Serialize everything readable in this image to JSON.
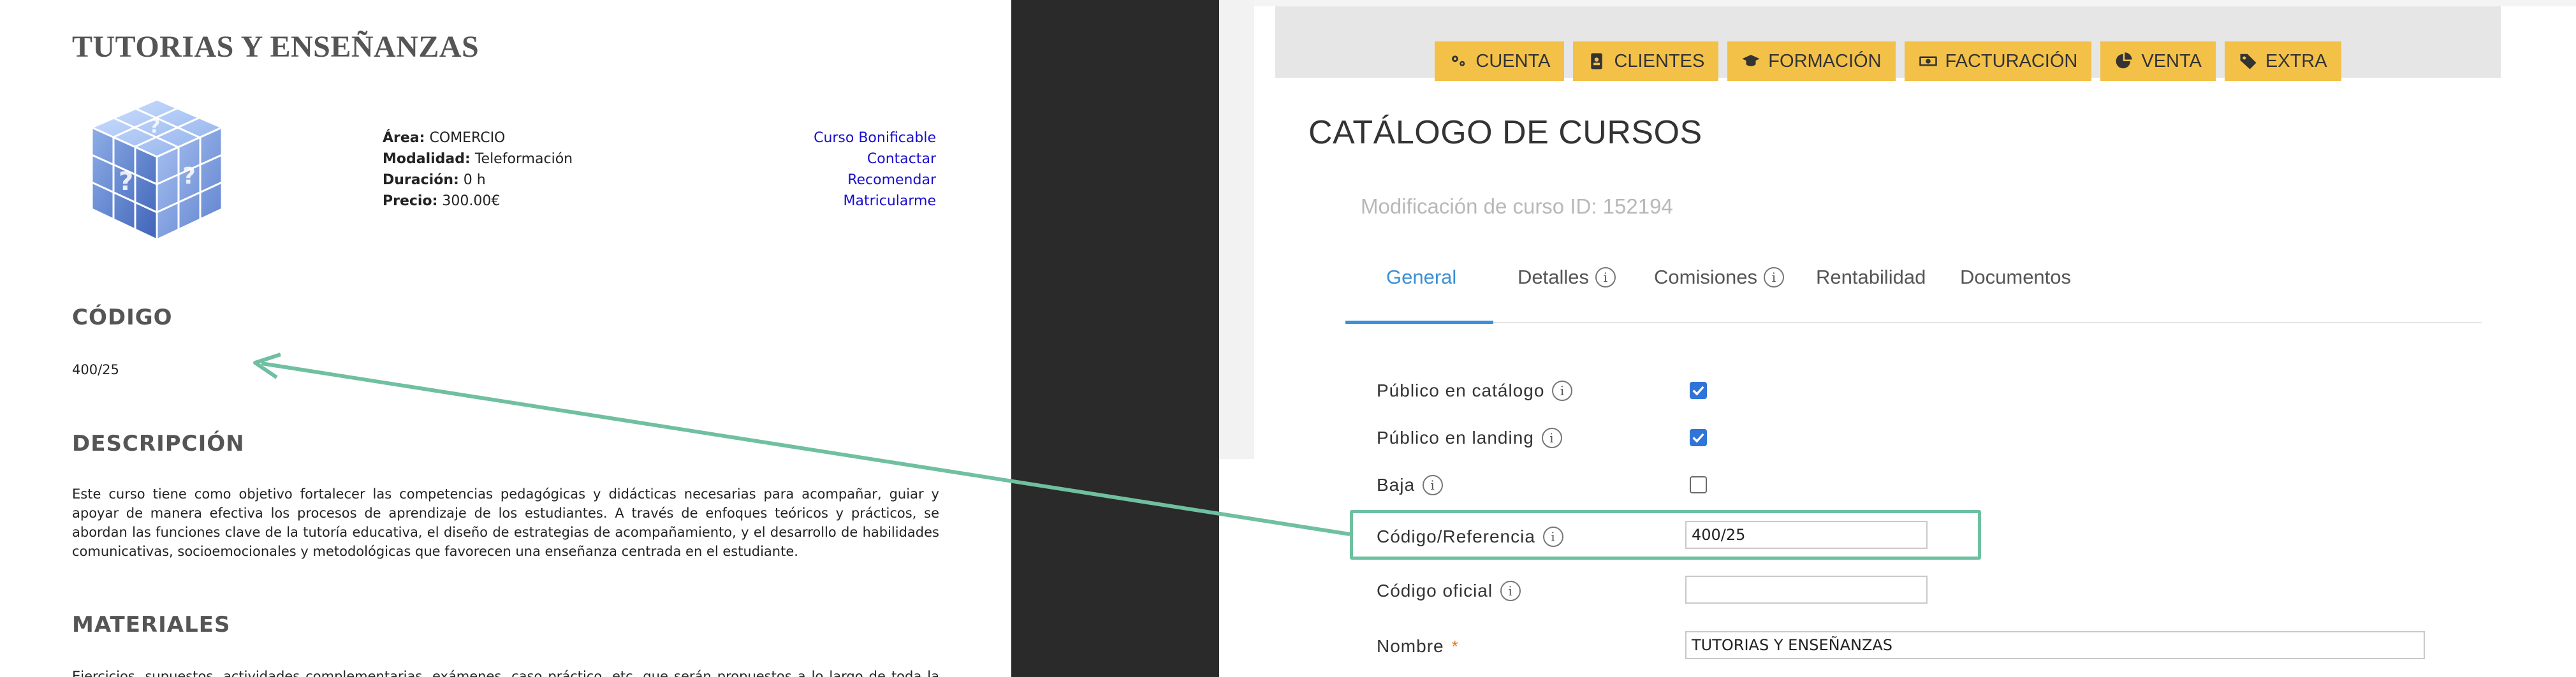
{
  "course_page": {
    "title": "TUTORIAS Y ENSEÑANZAS",
    "info": {
      "area_label": "Área:",
      "area_value": "COMERCIO",
      "modalidad_label": "Modalidad:",
      "modalidad_value": "Teleformación",
      "duracion_label": "Duración:",
      "duracion_value": "0 h",
      "precio_label": "Precio:",
      "precio_value": "300.00€"
    },
    "links": [
      "Curso Bonificable",
      "Contactar",
      "Recomendar",
      "Matricularme"
    ],
    "codigo_heading": "CÓDIGO",
    "codigo_value": "400/25",
    "descripcion_heading": "DESCRIPCIÓN",
    "descripcion_text": "Este curso tiene como objetivo fortalecer las competencias pedagógicas y didácticas necesarias para acompañar, guiar y apoyar de manera efectiva los procesos de aprendizaje de los estudiantes. A través de enfoques teóricos y prácticos, se abordan las funciones clave de la tutoría educativa, el diseño de estrategias de acompañamiento, y el desarrollo de habilidades comunicativas, socioemocionales y metodológicas que favorecen una enseñanza centrada en el estudiante.",
    "materiales_heading": "MATERIALES",
    "materiales_text": "Ejercicios, supuestos, actividades complementarias, exámenes, caso práctico, etc. que serán propuestos a lo largo de toda la formación."
  },
  "admin": {
    "nav": [
      {
        "label": "CUENTA",
        "icon": "cogs-icon"
      },
      {
        "label": "CLIENTES",
        "icon": "address-book-icon"
      },
      {
        "label": "FORMACIÓN",
        "icon": "graduation-cap-icon"
      },
      {
        "label": "FACTURACIÓN",
        "icon": "money-bill-icon"
      },
      {
        "label": "VENTA",
        "icon": "chart-pie-icon"
      },
      {
        "label": "EXTRA",
        "icon": "tags-icon"
      }
    ],
    "page_title": "CATÁLOGO DE CURSOS",
    "subtitle": "Modificación de curso ID: 152194",
    "tabs": [
      "General",
      "Detalles",
      "Comisiones",
      "Rentabilidad",
      "Documentos"
    ],
    "active_tab": "General",
    "form": {
      "publico_catalogo_label": "Público en catálogo",
      "publico_catalogo_checked": true,
      "publico_landing_label": "Público en landing",
      "publico_landing_checked": true,
      "baja_label": "Baja",
      "baja_checked": false,
      "codigo_label": "Código/Referencia",
      "codigo_value": "400/25",
      "codigo_oficial_label": "Código oficial",
      "codigo_oficial_value": "",
      "nombre_label": "Nombre",
      "nombre_required_mark": "*",
      "nombre_value": "TUTORIAS Y ENSEÑANZAS"
    }
  },
  "colors": {
    "nav_button": "#f3c148",
    "active_tab": "#3a8fd6",
    "highlight": "#6fc0a0",
    "checkbox": "#2f74d8",
    "link": "#1a0dcc"
  }
}
